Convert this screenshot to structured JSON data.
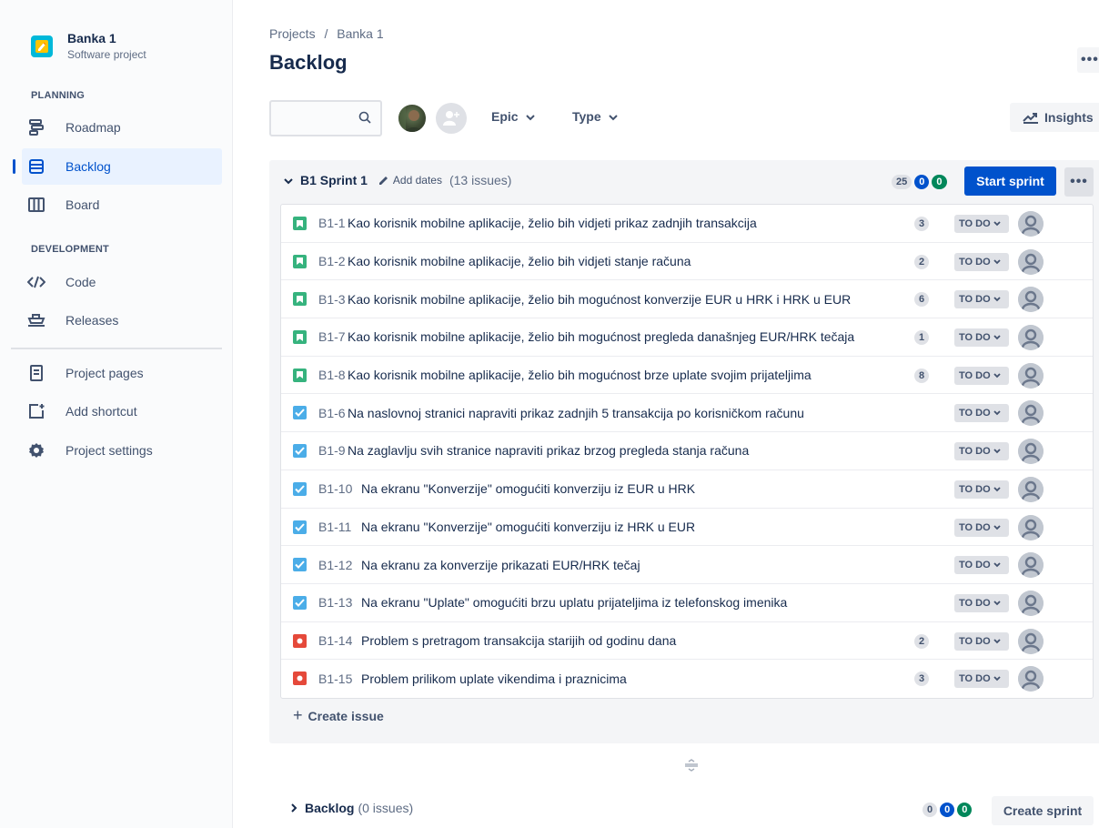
{
  "project": {
    "name": "Banka 1",
    "type": "Software project",
    "logo_icon": "project-logo-icon"
  },
  "sidebar": {
    "planning_label": "PLANNING",
    "development_label": "DEVELOPMENT",
    "items": [
      {
        "label": "Roadmap",
        "icon": "roadmap-icon"
      },
      {
        "label": "Backlog",
        "icon": "backlog-icon",
        "active": true
      },
      {
        "label": "Board",
        "icon": "board-icon"
      },
      {
        "label": "Code",
        "icon": "code-icon"
      },
      {
        "label": "Releases",
        "icon": "releases-icon"
      },
      {
        "label": "Project pages",
        "icon": "project-pages-icon"
      },
      {
        "label": "Add shortcut",
        "icon": "add-shortcut-icon"
      },
      {
        "label": "Project settings",
        "icon": "settings-icon"
      }
    ]
  },
  "header": {
    "breadcrumb_projects": "Projects",
    "breadcrumb_sep": "/",
    "breadcrumb_project": "Banka 1",
    "title": "Backlog",
    "more": "•••"
  },
  "toolbar": {
    "search_placeholder": "",
    "epic_label": "Epic",
    "type_label": "Type",
    "insights_label": "Insights"
  },
  "sprint": {
    "name": "B1 Sprint 1",
    "add_dates": "Add dates",
    "issue_count": "(13 issues)",
    "points_todo": "25",
    "points_inprogress": "0",
    "points_done": "0",
    "start_label": "Start sprint",
    "more": "•••",
    "issues": [
      {
        "key": "B1-1",
        "summary": "Kao korisnik mobilne aplikacije, želio bih vidjeti prikaz zadnjih transakcija",
        "type": "story",
        "estimate": "3",
        "status": "TO DO"
      },
      {
        "key": "B1-2",
        "summary": "Kao korisnik mobilne aplikacije, želio bih vidjeti stanje računa",
        "type": "story",
        "estimate": "2",
        "status": "TO DO"
      },
      {
        "key": "B1-3",
        "summary": "Kao korisnik mobilne aplikacije, želio bih mogućnost konverzije EUR u HRK i HRK u EUR",
        "type": "story",
        "estimate": "6",
        "status": "TO DO"
      },
      {
        "key": "B1-7",
        "summary": "Kao korisnik mobilne aplikacije, želio bih mogućnost pregleda današnjeg EUR/HRK tečaja",
        "type": "story",
        "estimate": "1",
        "status": "TO DO"
      },
      {
        "key": "B1-8",
        "summary": "Kao korisnik mobilne aplikacije, želio bih mogućnost brze uplate svojim prijateljima",
        "type": "story",
        "estimate": "8",
        "status": "TO DO"
      },
      {
        "key": "B1-6",
        "summary": "Na naslovnoj stranici napraviti prikaz zadnjih 5 transakcija po korisničkom računu",
        "type": "task",
        "estimate": "",
        "status": "TO DO"
      },
      {
        "key": "B1-9",
        "summary": "Na zaglavlju svih stranice napraviti prikaz brzog pregleda stanja računa",
        "type": "task",
        "estimate": "",
        "status": "TO DO"
      },
      {
        "key": "B1-10",
        "summary": "Na ekranu \"Konverzije\" omogućiti konverziju iz EUR u HRK",
        "type": "task",
        "estimate": "",
        "status": "TO DO"
      },
      {
        "key": "B1-11",
        "summary": "Na ekranu \"Konverzije\" omogućiti konverziju iz HRK u EUR",
        "type": "task",
        "estimate": "",
        "status": "TO DO"
      },
      {
        "key": "B1-12",
        "summary": "Na ekranu za konverzije prikazati EUR/HRK tečaj",
        "type": "task",
        "estimate": "",
        "status": "TO DO"
      },
      {
        "key": "B1-13",
        "summary": "Na ekranu \"Uplate\" omogućiti brzu uplatu prijateljima iz telefonskog imenika",
        "type": "task",
        "estimate": "",
        "status": "TO DO"
      },
      {
        "key": "B1-14",
        "summary": "Problem s pretragom transakcija starijih od godinu dana",
        "type": "bug",
        "estimate": "2",
        "status": "TO DO"
      },
      {
        "key": "B1-15",
        "summary": "Problem prilikom uplate vikendima i praznicima",
        "type": "bug",
        "estimate": "3",
        "status": "TO DO"
      }
    ],
    "create_issue_label": "Create issue"
  },
  "backlog": {
    "name": "Backlog",
    "issue_count": "(0 issues)",
    "points_todo": "0",
    "points_inprogress": "0",
    "points_done": "0",
    "create_sprint_label": "Create sprint"
  },
  "colors": {
    "accent": "#0052cc",
    "story": "#36b37e",
    "task": "#4bade8",
    "bug": "#e5493a",
    "done": "#00875a"
  }
}
